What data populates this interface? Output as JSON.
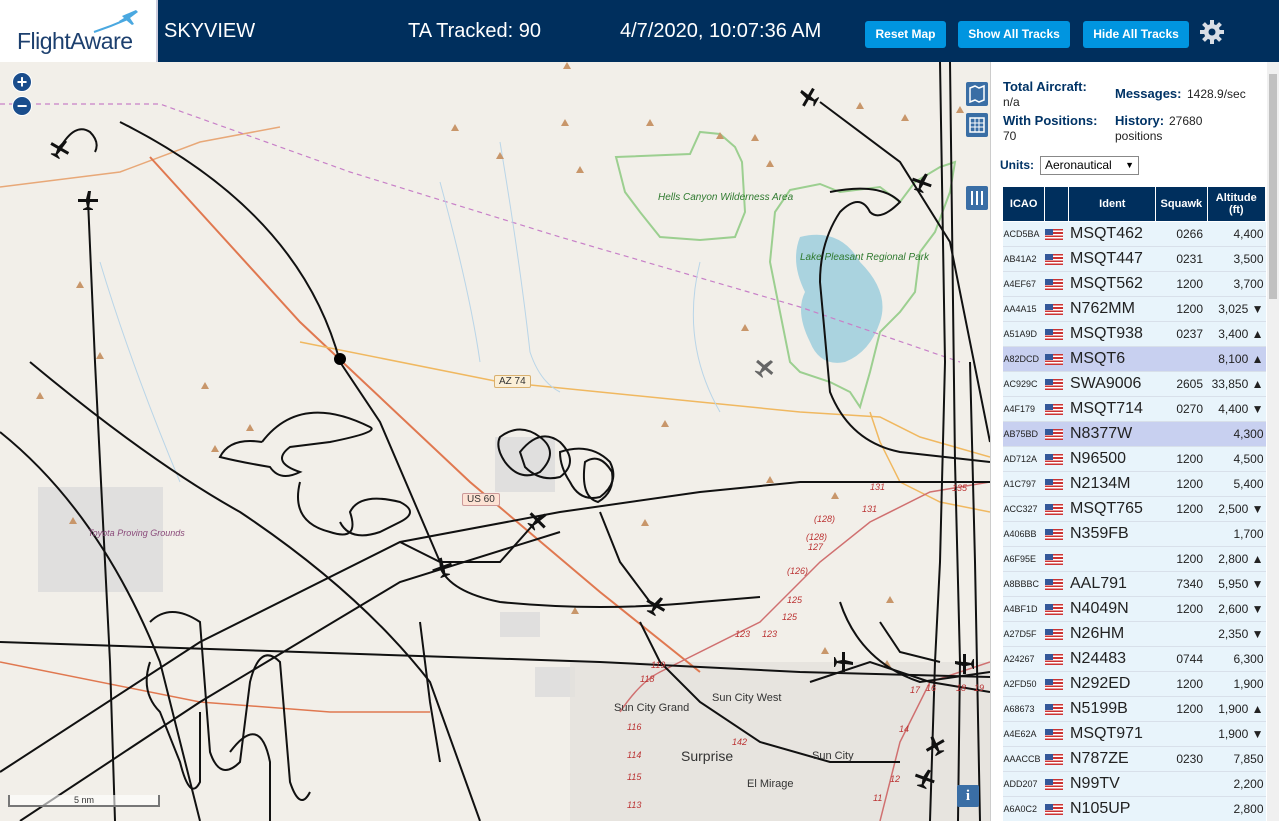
{
  "header": {
    "logo": "FlightAware",
    "app_name": "SKYVIEW",
    "tracked": "TA Tracked: 90",
    "datetime": "4/7/2020, 10:07:36 AM",
    "buttons": {
      "reset": "Reset Map",
      "show_all": "Show All Tracks",
      "hide_all": "Hide All Tracks"
    },
    "settings_icon": "gear-icon"
  },
  "map": {
    "labels": {
      "hells_canyon": "Hells Canyon Wilderness Area",
      "lake_pleasant": "Lake Pleasant Regional Park",
      "toyota": "Toyota Proving Grounds",
      "az74": "AZ 74",
      "us60": "US 60",
      "sun_city_grand": "Sun City Grand",
      "sun_city_west": "Sun City West",
      "surprise": "Surprise",
      "sun_city": "Sun City",
      "el_mirage": "El Mirage"
    },
    "route_numbers": [
      "131",
      "131",
      "135",
      "(128)",
      "(128)",
      "127",
      "(126)",
      "125",
      "125",
      "123",
      "123",
      "119",
      "118",
      "116",
      "115",
      "114",
      "113",
      "142",
      "17",
      "16",
      "18",
      "19",
      "14",
      "12",
      "11"
    ],
    "scale": "5 nm",
    "zoom_in": "+",
    "zoom_out": "−",
    "info": "i"
  },
  "panel": {
    "total_aircraft_label": "Total Aircraft:",
    "total_aircraft_value": "n/a",
    "with_positions_label": "With Positions:",
    "with_positions_value": "70",
    "messages_label": "Messages:",
    "messages_value": "1428.9/sec",
    "history_label": "History:",
    "history_value": "27680",
    "history_unit": "positions",
    "units_label": "Units:",
    "units_value": "Aeronautical",
    "columns": [
      "ICAO",
      "",
      "Ident",
      "Squawk",
      "Altitude (ft)"
    ],
    "rows": [
      {
        "icao": "ACD5BA",
        "ident": "MSQT462",
        "squawk": "0266",
        "alt": "4,400",
        "hl": false
      },
      {
        "icao": "AB41A2",
        "ident": "MSQT447",
        "squawk": "0231",
        "alt": "3,500",
        "hl": false
      },
      {
        "icao": "A4EF67",
        "ident": "MSQT562",
        "squawk": "1200",
        "alt": "3,700",
        "hl": false
      },
      {
        "icao": "AA4A15",
        "ident": "N762MM",
        "squawk": "1200",
        "alt": "3,025 ▼",
        "hl": false
      },
      {
        "icao": "A51A9D",
        "ident": "MSQT938",
        "squawk": "0237",
        "alt": "3,400 ▲",
        "hl": false
      },
      {
        "icao": "A82DCD",
        "ident": "MSQT6",
        "squawk": "",
        "alt": "8,100 ▲",
        "hl": true
      },
      {
        "icao": "AC929C",
        "ident": "SWA9006",
        "squawk": "2605",
        "alt": "33,850 ▲",
        "hl": false
      },
      {
        "icao": "A4F179",
        "ident": "MSQT714",
        "squawk": "0270",
        "alt": "4,400 ▼",
        "hl": false
      },
      {
        "icao": "AB75BD",
        "ident": "N8377W",
        "squawk": "",
        "alt": "4,300",
        "hl": true
      },
      {
        "icao": "AD712A",
        "ident": "N96500",
        "squawk": "1200",
        "alt": "4,500",
        "hl": false
      },
      {
        "icao": "A1C797",
        "ident": "N2134M",
        "squawk": "1200",
        "alt": "5,400",
        "hl": false
      },
      {
        "icao": "ACC327",
        "ident": "MSQT765",
        "squawk": "1200",
        "alt": "2,500 ▼",
        "hl": false
      },
      {
        "icao": "A406BB",
        "ident": "N359FB",
        "squawk": "",
        "alt": "1,700",
        "hl": false
      },
      {
        "icao": "A6F95E",
        "ident": "",
        "squawk": "1200",
        "alt": "2,800 ▲",
        "hl": false
      },
      {
        "icao": "A8BBBC",
        "ident": "AAL791",
        "squawk": "7340",
        "alt": "5,950 ▼",
        "hl": false
      },
      {
        "icao": "A4BF1D",
        "ident": "N4049N",
        "squawk": "1200",
        "alt": "2,600 ▼",
        "hl": false
      },
      {
        "icao": "A27D5F",
        "ident": "N26HM",
        "squawk": "",
        "alt": "2,350 ▼",
        "hl": false
      },
      {
        "icao": "A24267",
        "ident": "N24483",
        "squawk": "0744",
        "alt": "6,300",
        "hl": false
      },
      {
        "icao": "A2FD50",
        "ident": "N292ED",
        "squawk": "1200",
        "alt": "1,900",
        "hl": false
      },
      {
        "icao": "A68673",
        "ident": "N5199B",
        "squawk": "1200",
        "alt": "1,900 ▲",
        "hl": false
      },
      {
        "icao": "A4E62A",
        "ident": "MSQT971",
        "squawk": "",
        "alt": "1,900 ▼",
        "hl": false
      },
      {
        "icao": "AAACCB",
        "ident": "N787ZE",
        "squawk": "0230",
        "alt": "7,850",
        "hl": false
      },
      {
        "icao": "ADD207",
        "ident": "N99TV",
        "squawk": "",
        "alt": "2,200",
        "hl": false
      },
      {
        "icao": "A6A0C2",
        "ident": "N105UP",
        "squawk": "",
        "alt": "2,800",
        "hl": false
      }
    ]
  }
}
